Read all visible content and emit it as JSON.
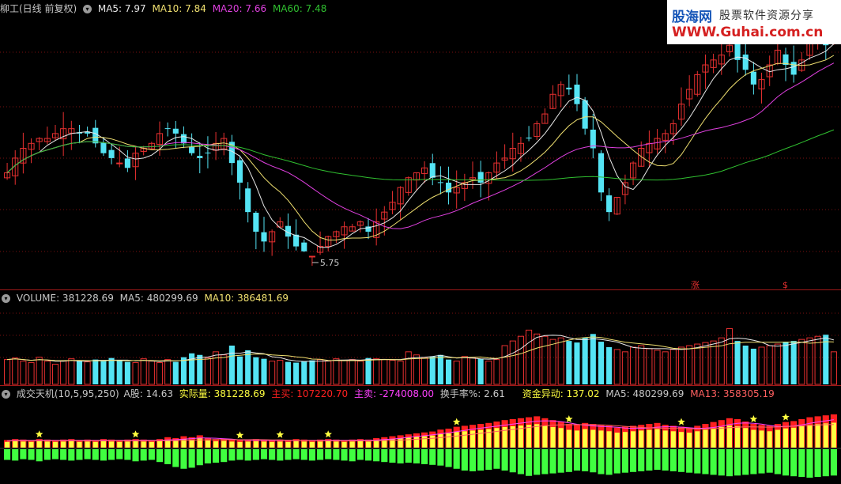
{
  "colors": {
    "up": "#e83030",
    "down": "#54e4f4",
    "ma5": "#e8e8e8",
    "ma10": "#f0e070",
    "ma20": "#e040e0",
    "ma60": "#30c030",
    "grid": "#7a1010",
    "hdr_white": "#c8c8c8",
    "yellow": "#ffff40",
    "green": "#40ff40",
    "red": "#ff2020",
    "magenta": "#ff40ff",
    "pink": "#ff6060"
  },
  "main": {
    "title": "柳工(日线 前复权)",
    "ma5": "MA5: 7.97",
    "ma10": "MA10: 7.84",
    "ma20": "MA20: 7.66",
    "ma60": "MA60: 7.48",
    "low_label": "5.75",
    "mark1": "涨",
    "mark2": "$"
  },
  "volume": {
    "label": "VOLUME: 381228.69",
    "ma5": "MA5: 480299.69",
    "ma10": "MA10: 386481.69"
  },
  "capital": {
    "title": "成交天机(10,5,95,250)",
    "a_share": "A股: 14.63",
    "actual": "实际量: 381228.69",
    "buy": "主买: 107220.70",
    "sell": "主卖: -274008.00",
    "turnover": "换手率%: 2.61",
    "anomaly": "资金异动: 137.02",
    "ma5": "MA5: 480299.69",
    "ma13": "MA13: 358305.19"
  },
  "logo": {
    "name": "股海网",
    "tag": "股票软件资源分享",
    "url": "WWW.Guhai.com.cn"
  },
  "chart_data": [
    {
      "type": "candlestick",
      "title": "柳工(日线 前复权)",
      "ylim": [
        5.5,
        8.2
      ],
      "close": [
        6.6,
        6.75,
        6.85,
        6.9,
        6.95,
        6.95,
        7.0,
        7.05,
        7.05,
        7.0,
        7.0,
        6.9,
        6.8,
        6.75,
        6.7,
        6.65,
        6.8,
        6.85,
        6.9,
        7.0,
        7.05,
        7.0,
        6.9,
        6.8,
        6.75,
        6.8,
        6.9,
        6.95,
        6.7,
        6.5,
        6.2,
        6.0,
        5.9,
        6.0,
        6.1,
        5.95,
        5.85,
        5.8,
        5.75,
        5.85,
        5.95,
        6.0,
        6.05,
        6.05,
        6.1,
        6.0,
        6.1,
        6.2,
        6.3,
        6.45,
        6.55,
        6.6,
        6.65,
        6.55,
        6.5,
        6.4,
        6.45,
        6.5,
        6.55,
        6.5,
        6.6,
        6.7,
        6.75,
        6.85,
        6.9,
        6.95,
        7.1,
        7.2,
        7.4,
        7.5,
        7.45,
        7.3,
        7.05,
        6.85,
        6.4,
        6.2,
        6.35,
        6.5,
        6.7,
        6.85,
        6.9,
        6.95,
        7.0,
        7.1,
        7.3,
        7.45,
        7.6,
        7.7,
        7.75,
        7.8,
        7.9,
        7.75,
        7.65,
        7.5,
        7.55,
        7.7,
        7.85,
        7.7,
        7.6,
        7.75,
        7.95,
        8.0,
        7.9,
        7.97
      ]
    },
    {
      "type": "bar",
      "title": "VOLUME",
      "ylim": [
        0,
        1000000
      ],
      "values": [
        320000,
        340000,
        300000,
        280000,
        350000,
        300000,
        260000,
        300000,
        330000,
        310000,
        290000,
        320000,
        300000,
        340000,
        310000,
        290000,
        280000,
        330000,
        300000,
        280000,
        320000,
        290000,
        350000,
        400000,
        380000,
        340000,
        420000,
        380000,
        500000,
        360000,
        440000,
        350000,
        330000,
        300000,
        310000,
        290000,
        280000,
        300000,
        310000,
        320000,
        300000,
        330000,
        310000,
        320000,
        300000,
        340000,
        330000,
        320000,
        310000,
        300000,
        420000,
        380000,
        340000,
        360000,
        380000,
        320000,
        300000,
        360000,
        340000,
        330000,
        300000,
        320000,
        500000,
        560000,
        620000,
        700000,
        650000,
        620000,
        580000,
        600000,
        560000,
        540000,
        600000,
        650000,
        550000,
        480000,
        450000,
        420000,
        480000,
        500000,
        460000,
        440000,
        420000,
        450000,
        480000,
        500000,
        520000,
        540000,
        560000,
        600000,
        720000,
        560000,
        500000,
        460000,
        480000,
        500000,
        520000,
        550000,
        560000,
        580000,
        600000,
        620000,
        640000,
        420000
      ]
    },
    {
      "type": "bar",
      "title": "成交天机(10,5,95,250)",
      "series": [
        {
          "name": "主买",
          "values": [
            0.16,
            0.18,
            0.17,
            0.16,
            0.18,
            0.17,
            0.16,
            0.17,
            0.18,
            0.16,
            0.17,
            0.16,
            0.18,
            0.17,
            0.16,
            0.17,
            0.18,
            0.17,
            0.16,
            0.18,
            0.22,
            0.2,
            0.24,
            0.22,
            0.26,
            0.2,
            0.18,
            0.19,
            0.17,
            0.16,
            0.17,
            0.18,
            0.17,
            0.16,
            0.17,
            0.16,
            0.18,
            0.17,
            0.16,
            0.17,
            0.18,
            0.17,
            0.16,
            0.17,
            0.18,
            0.17,
            0.2,
            0.22,
            0.24,
            0.26,
            0.28,
            0.3,
            0.32,
            0.34,
            0.38,
            0.4,
            0.44,
            0.46,
            0.48,
            0.5,
            0.52,
            0.55,
            0.58,
            0.6,
            0.62,
            0.64,
            0.66,
            0.62,
            0.58,
            0.55,
            0.5,
            0.48,
            0.52,
            0.5,
            0.48,
            0.46,
            0.42,
            0.44,
            0.46,
            0.48,
            0.5,
            0.52,
            0.48,
            0.46,
            0.44,
            0.42,
            0.46,
            0.5,
            0.54,
            0.58,
            0.62,
            0.6,
            0.55,
            0.5,
            0.48,
            0.46,
            0.5,
            0.54,
            0.56,
            0.6,
            0.64,
            0.66,
            0.68,
            0.7
          ]
        },
        {
          "name": "主卖",
          "values": [
            -0.3,
            -0.32,
            -0.28,
            -0.3,
            -0.34,
            -0.3,
            -0.28,
            -0.3,
            -0.32,
            -0.3,
            -0.28,
            -0.3,
            -0.32,
            -0.3,
            -0.28,
            -0.3,
            -0.34,
            -0.32,
            -0.3,
            -0.36,
            -0.42,
            -0.5,
            -0.55,
            -0.52,
            -0.45,
            -0.4,
            -0.38,
            -0.36,
            -0.32,
            -0.3,
            -0.32,
            -0.3,
            -0.28,
            -0.3,
            -0.32,
            -0.3,
            -0.28,
            -0.3,
            -0.32,
            -0.3,
            -0.28,
            -0.3,
            -0.32,
            -0.34,
            -0.3,
            -0.32,
            -0.34,
            -0.36,
            -0.38,
            -0.4,
            -0.38,
            -0.4,
            -0.42,
            -0.44,
            -0.46,
            -0.5,
            -0.55,
            -0.6,
            -0.62,
            -0.6,
            -0.58,
            -0.55,
            -0.6,
            -0.65,
            -0.7,
            -0.75,
            -0.72,
            -0.7,
            -0.68,
            -0.66,
            -0.64,
            -0.6,
            -0.62,
            -0.65,
            -0.7,
            -0.72,
            -0.68,
            -0.66,
            -0.64,
            -0.62,
            -0.6,
            -0.58,
            -0.6,
            -0.62,
            -0.64,
            -0.66,
            -0.68,
            -0.7,
            -0.72,
            -0.74,
            -0.76,
            -0.74,
            -0.72,
            -0.7,
            -0.68,
            -0.66,
            -0.7,
            -0.74,
            -0.76,
            -0.78,
            -0.8,
            -0.78,
            -0.76,
            -0.74
          ]
        }
      ]
    }
  ]
}
